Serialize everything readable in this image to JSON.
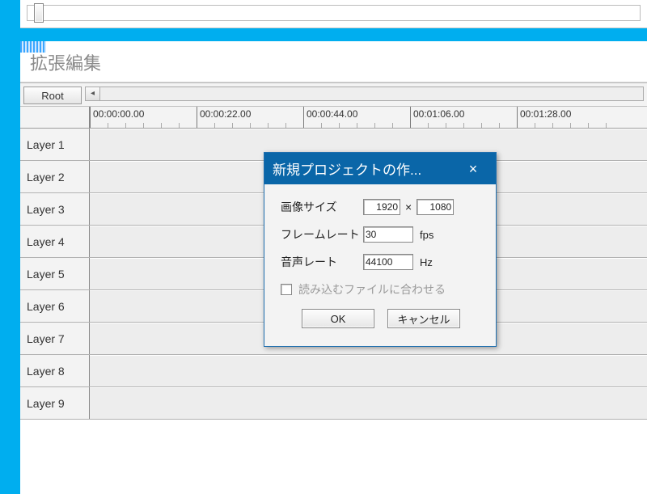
{
  "editor": {
    "title": "拡張編集",
    "root_button": "Root"
  },
  "ruler": {
    "ticks": [
      {
        "pos": 0,
        "label": "00:00:00.00"
      },
      {
        "pos": 132,
        "label": "00:00:22.00"
      },
      {
        "pos": 264,
        "label": "00:00:44.00"
      },
      {
        "pos": 396,
        "label": "00:01:06.00"
      },
      {
        "pos": 528,
        "label": "00:01:28.00"
      }
    ]
  },
  "layers": [
    {
      "label": "Layer 1"
    },
    {
      "label": "Layer 2"
    },
    {
      "label": "Layer 3"
    },
    {
      "label": "Layer 4"
    },
    {
      "label": "Layer 5"
    },
    {
      "label": "Layer 6"
    },
    {
      "label": "Layer 7"
    },
    {
      "label": "Layer 8"
    },
    {
      "label": "Layer 9"
    }
  ],
  "dialog": {
    "title": "新規プロジェクトの作...",
    "image_size_label": "画像サイズ",
    "width": "1920",
    "x": "×",
    "height": "1080",
    "frame_rate_label": "フレームレート",
    "frame_rate": "30",
    "fps_unit": "fps",
    "audio_rate_label": "音声レート",
    "audio_rate": "44100",
    "hz_unit": "Hz",
    "checkbox_label": "読み込むファイルに合わせる",
    "ok": "OK",
    "cancel": "キャンセル"
  }
}
